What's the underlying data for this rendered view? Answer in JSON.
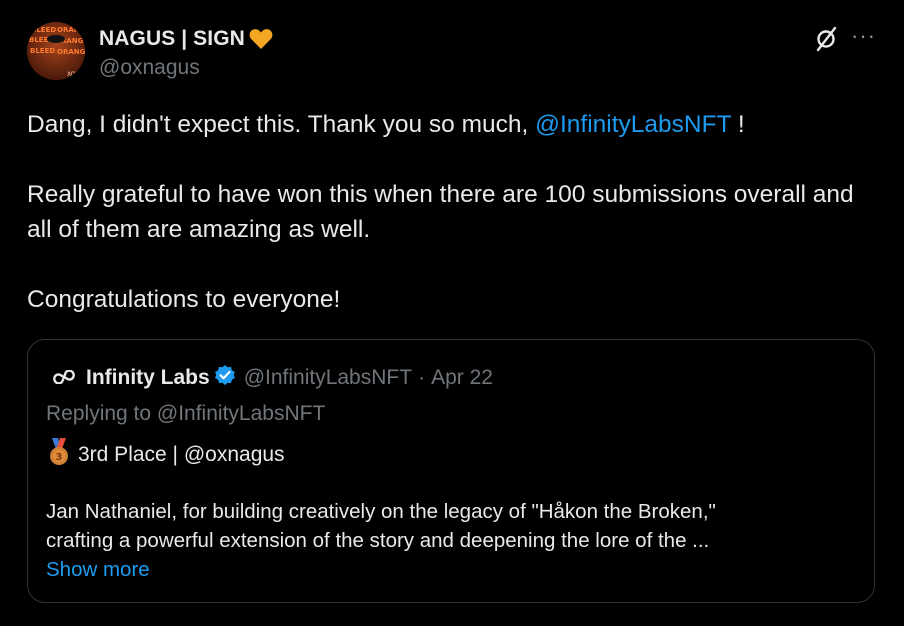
{
  "author": {
    "display_name": "NAGUS | SIGN",
    "badge_emoji": "🧡",
    "handle": "@oxnagus",
    "avatar_text": [
      "BLEED",
      "ORANGE",
      "BLEED",
      "ORANGE",
      "BLEED",
      "ORANGE",
      "XOX"
    ]
  },
  "tweet": {
    "line1_prefix": "Dang, I didn't expect this. Thank you so much, ",
    "line1_mention": "@InfinityLabsNFT",
    "line1_suffix": " !",
    "paragraph2": "Really grateful to have won this when there are 100 submissions overall and all of them are amazing as well.",
    "paragraph3": "Congratulations to everyone!"
  },
  "quote": {
    "display_name": "Infinity Labs",
    "handle": "@InfinityLabsNFT",
    "separator": "·",
    "date": "Apr 22",
    "replying_to": "Replying to @InfinityLabsNFT",
    "medal_number": "3",
    "place_text": "3rd Place | @oxnagus",
    "body_line1": "Jan Nathaniel, for building creatively on the legacy of \"Håkon the Broken,\"",
    "body_line2": "crafting a powerful extension of the story and deepening the lore of the ...",
    "show_more": "Show more"
  },
  "icons": {
    "grok": "grok-icon",
    "more": "more-icon",
    "more_glyph": "···"
  },
  "colors": {
    "background": "#000000",
    "text": "#e7e9ea",
    "muted": "#71767b",
    "link": "#1d9bf0",
    "border": "#2f3336",
    "heart": "#f5a623",
    "avatar_bg": "#5a1e0c"
  }
}
